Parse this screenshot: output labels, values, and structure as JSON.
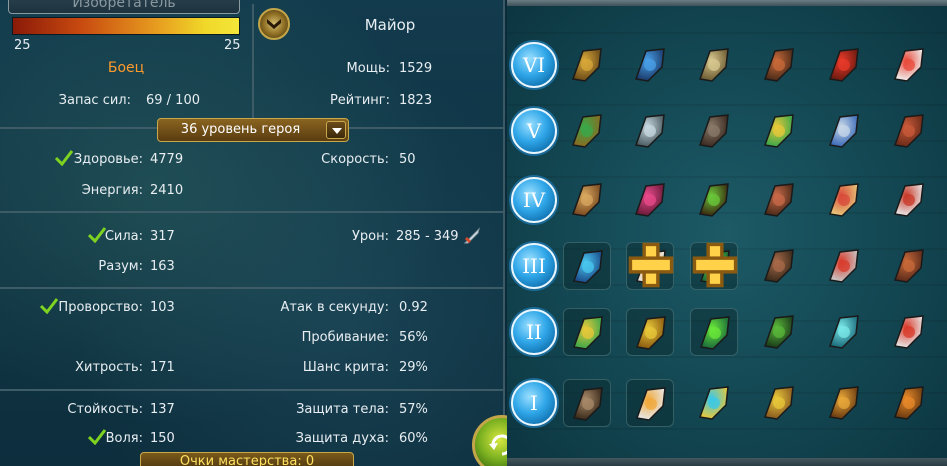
{
  "hero": {
    "class_title": "Изобретатель",
    "xp_left": "25",
    "xp_right": "25",
    "xp_progress": 1.0,
    "role": "Боец",
    "stamina_label": "Запас сил:",
    "stamina_value": "69 / 100",
    "rank_name": "Майор",
    "power_label": "Мощь:",
    "power_value": "1529",
    "rating_label": "Рейтинг:",
    "rating_value": "1823",
    "level_select": "36 уровень героя"
  },
  "stats": {
    "health_label": "Здоровье:",
    "health_value": "4779",
    "energy_label": "Энергия:",
    "energy_value": "2410",
    "speed_label": "Скорость:",
    "speed_value": "50",
    "strength_label": "Сила:",
    "strength_value": "317",
    "intellect_label": "Разум:",
    "intellect_value": "163",
    "damage_label": "Урон:",
    "damage_value": "285 - 349",
    "agility_label": "Проворство:",
    "agility_value": "103",
    "cunning_label": "Хитрость:",
    "cunning_value": "171",
    "aps_label": "Атак в секунду:",
    "aps_value": "0.92",
    "pierce_label": "Пробивание:",
    "pierce_value": "56%",
    "crit_label": "Шанс крита:",
    "crit_value": "29%",
    "stamina2_label": "Стойкость:",
    "stamina2_value": "137",
    "will_label": "Воля:",
    "will_value": "150",
    "body_def_label": "Защита тела:",
    "body_def_value": "57%",
    "spirit_def_label": "Защита духа:",
    "spirit_def_value": "60%"
  },
  "mastery_label": "Очки мастерства: 0",
  "tiers": [
    "VI",
    "V",
    "IV",
    "III",
    "II",
    "I"
  ],
  "talent_icons": [
    [
      "spyglass-icon",
      "crossed-blades-icon",
      "elephant-icon",
      "hammer-icon",
      "red-banner-icon",
      "shield-cross-icon"
    ],
    [
      "belt-icon",
      "shuriken-icon",
      "spiked-mace-icon",
      "jeweled-sword-icon",
      "crossed-swords-icon",
      "armor-icon"
    ],
    [
      "scroll-icon",
      "necklace-icon",
      "sprout-icon",
      "gauntlet-icon",
      "book-icon",
      "winged-boot-icon"
    ],
    [
      "ice-shards-icon",
      "clock-burst-icon",
      "atom-icon",
      "pickaxe-icon",
      "dagger-icon",
      "coil-icon"
    ],
    [
      "sun-amulet-icon",
      "discount-ticket-icon",
      "atom-icon",
      "kettlebell-icon",
      "potion-icon",
      "red-blade-icon"
    ],
    [
      "turret-icon",
      "clock-burst-icon",
      "pinwheel-icon",
      "snail-icon",
      "lynx-icon",
      "gear-icon"
    ]
  ],
  "colors": {
    "role": "#ff9a2a",
    "check": "#7ed321",
    "tier_blue": "#2fa6e8",
    "mastery": "#ffe060"
  }
}
